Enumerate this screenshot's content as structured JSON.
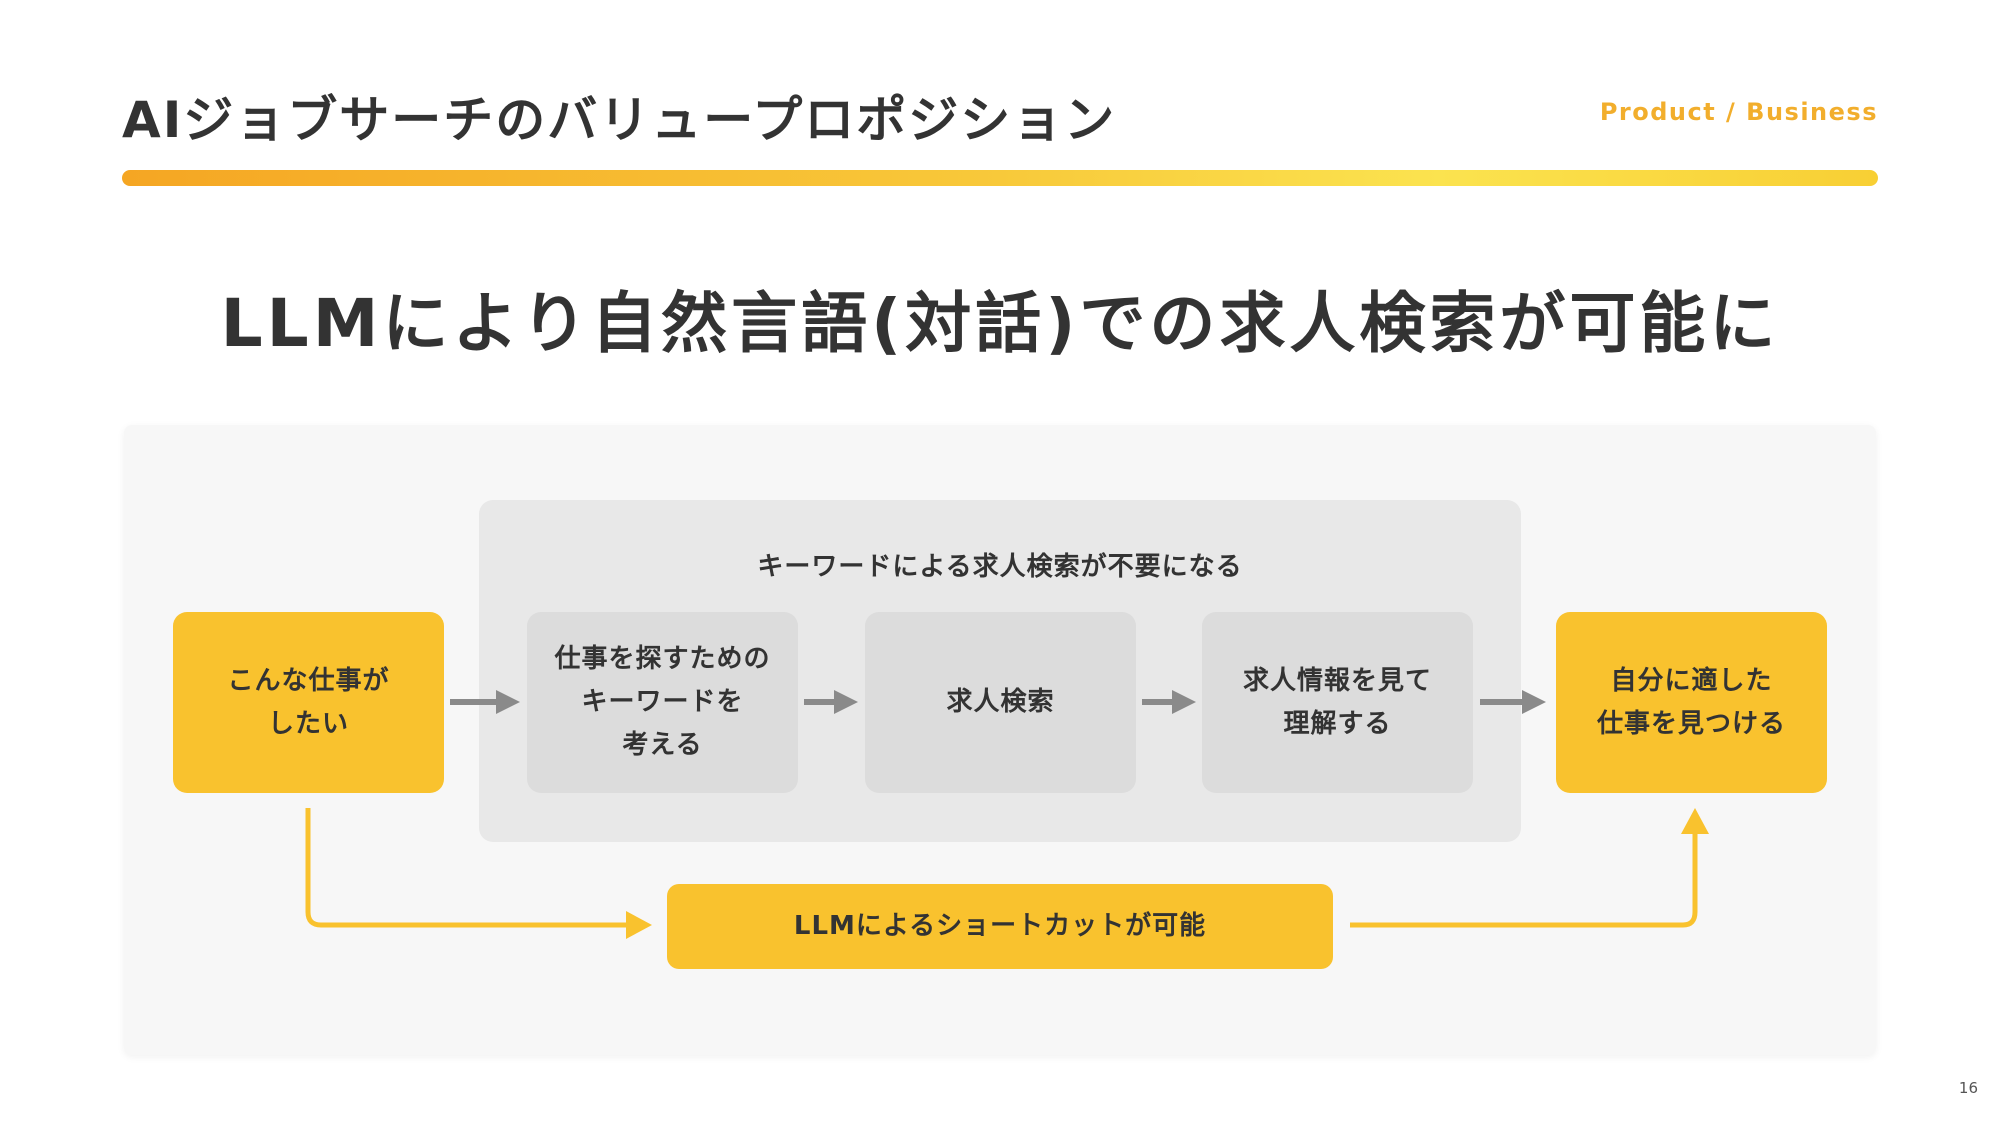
{
  "header": {
    "title": "AIジョブサーチのバリュープロポジション",
    "category": "Product / Business"
  },
  "headline": "LLMにより自然言語(対話)での求人検索が可能に",
  "diagram": {
    "start": "こんな仕事が\nしたい",
    "group_label": "キーワードによる求人検索が不要になる",
    "steps": [
      "仕事を探すための\nキーワードを\n考える",
      "求人検索",
      "求人情報を見て\n理解する"
    ],
    "goal": "自分に適した\n仕事を見つける",
    "shortcut": "LLMによるショートカットが可能",
    "icons": {
      "flow_arrow": "arrow-right-icon",
      "shortcut_arrow": "arrow-connector-icon"
    },
    "colors": {
      "accent_yellow": "#f9c22e",
      "gray_box": "#dcdcdc",
      "arrow_gray": "#8a8a8a"
    }
  },
  "footer": {
    "page_number": "16"
  }
}
